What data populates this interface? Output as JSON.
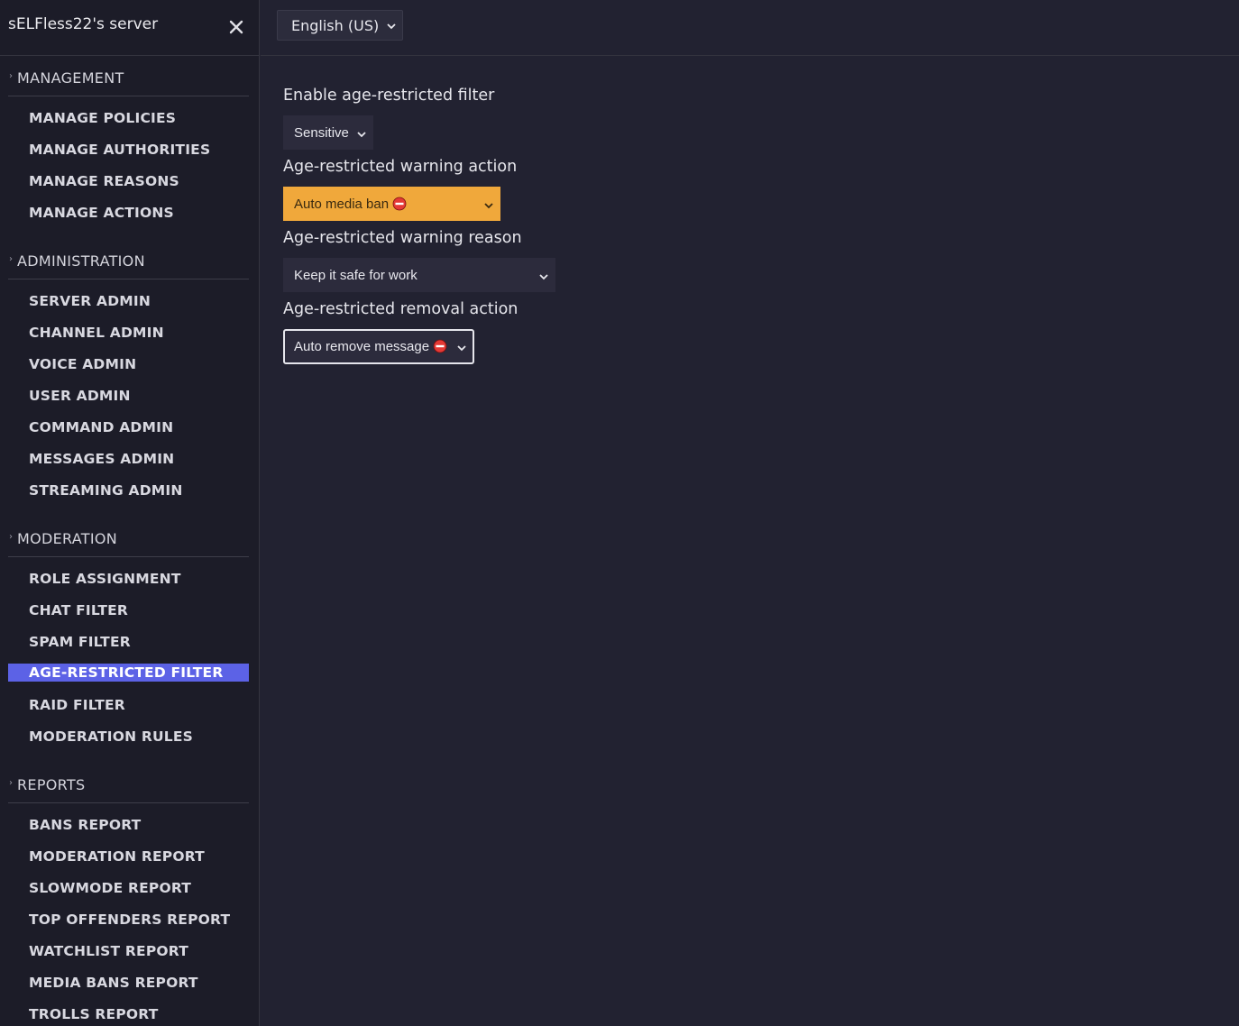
{
  "header": {
    "server_name": "sELFless22's server",
    "language": "English (US)"
  },
  "sidebar": {
    "sections": [
      {
        "title": "MANAGEMENT",
        "items": [
          "MANAGE POLICIES",
          "MANAGE AUTHORITIES",
          "MANAGE REASONS",
          "MANAGE ACTIONS"
        ]
      },
      {
        "title": "ADMINISTRATION",
        "items": [
          "SERVER ADMIN",
          "CHANNEL ADMIN",
          "VOICE ADMIN",
          "USER ADMIN",
          "COMMAND ADMIN",
          "MESSAGES ADMIN",
          "STREAMING ADMIN"
        ]
      },
      {
        "title": "MODERATION",
        "items": [
          "ROLE ASSIGNMENT",
          "CHAT FILTER",
          "SPAM FILTER",
          "AGE-RESTRICTED FILTER",
          "RAID FILTER",
          "MODERATION RULES"
        ]
      },
      {
        "title": "REPORTS",
        "items": [
          "BANS REPORT",
          "MODERATION REPORT",
          "SLOWMODE REPORT",
          "TOP OFFENDERS REPORT",
          "WATCHLIST REPORT",
          "MEDIA BANS REPORT",
          "TROLLS REPORT"
        ]
      }
    ],
    "active_item": "AGE-RESTRICTED FILTER"
  },
  "main": {
    "filter_label": "Enable age-restricted filter",
    "filter_value": "Sensitive",
    "warning_action_label": "Age-restricted warning action",
    "warning_action_value": "Auto media ban",
    "warning_reason_label": "Age-restricted warning reason",
    "warning_reason_value": "Keep it safe for work",
    "removal_action_label": "Age-restricted removal action",
    "removal_action_value": "Auto remove message"
  },
  "colors": {
    "accent": "#5c62e6",
    "warning": "#f0a83b",
    "stop": "#e53935"
  }
}
